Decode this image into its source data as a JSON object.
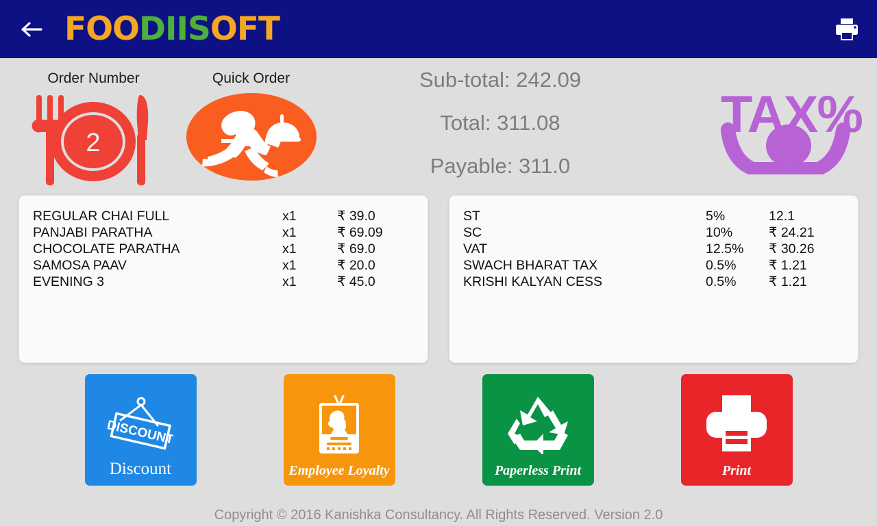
{
  "appbar": {
    "back_icon": "arrow-left-icon",
    "logo_part1": "FOO",
    "logo_part2": "DIIS",
    "logo_part3": "OFT",
    "print_icon": "printer-icon"
  },
  "summary": {
    "order_number_label": "Order Number",
    "order_number_value": "2",
    "quick_order_label": "Quick Order",
    "sub_total": "Sub-total: 242.09",
    "total": "Total: 311.08",
    "payable": "Payable: 311.0",
    "tax_icon_text": "TAX%"
  },
  "order_items": [
    {
      "name": "REGULAR CHAI FULL",
      "qty": "x1",
      "amount": "₹ 39.0"
    },
    {
      "name": "PANJABI PARATHA",
      "qty": "x1",
      "amount": "₹ 69.09"
    },
    {
      "name": "CHOCOLATE PARATHA",
      "qty": "x1",
      "amount": "₹ 69.0"
    },
    {
      "name": "SAMOSA PAAV",
      "qty": "x1",
      "amount": "₹ 20.0"
    },
    {
      "name": "EVENING 3",
      "qty": "x1",
      "amount": "₹ 45.0"
    }
  ],
  "taxes": [
    {
      "name": "ST",
      "rate": "5%",
      "amount": "12.1"
    },
    {
      "name": "SC",
      "rate": "10%",
      "amount": "₹ 24.21"
    },
    {
      "name": "VAT",
      "rate": "12.5%",
      "amount": "₹ 30.26"
    },
    {
      "name": "SWACH BHARAT TAX",
      "rate": "0.5%",
      "amount": "₹ 1.21"
    },
    {
      "name": "KRISHI KALYAN CESS",
      "rate": "0.5%",
      "amount": "₹ 1.21"
    }
  ],
  "actions": [
    {
      "label": "Discount",
      "icon": "discount-tag-icon",
      "color": "#1f88e5"
    },
    {
      "label": "Employee Loyalty",
      "icon": "id-badge-icon",
      "color": "#f7960d"
    },
    {
      "label": "Paperless Print",
      "icon": "recycle-icon",
      "color": "#0a9245"
    },
    {
      "label": "Print",
      "icon": "printer-icon",
      "color": "#e8262a"
    }
  ],
  "footer": {
    "copyright": "Copyright © 2016 Kanishka Consultancy. All Rights Reserved. Version 2.0"
  },
  "colors": {
    "appbar": "#0e1184",
    "background": "#dedede",
    "panel": "#fafafa",
    "accent_red": "#ef4136",
    "accent_orange": "#f95e20",
    "accent_purple": "#b濒"
  }
}
